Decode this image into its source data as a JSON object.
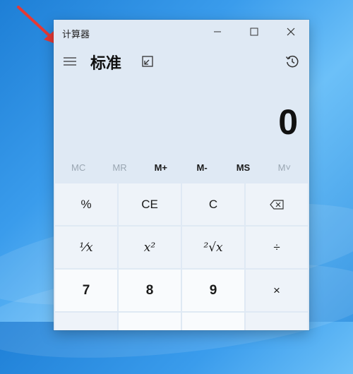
{
  "window": {
    "title": "计算器"
  },
  "header": {
    "mode": "标准"
  },
  "display": {
    "value": "0"
  },
  "memory": [
    {
      "label": "MC",
      "enabled": false
    },
    {
      "label": "MR",
      "enabled": false
    },
    {
      "label": "M+",
      "enabled": true
    },
    {
      "label": "M-",
      "enabled": true
    },
    {
      "label": "MS",
      "enabled": true
    },
    {
      "label": "M˅",
      "enabled": false
    }
  ],
  "keys": {
    "percent": "%",
    "ce": "CE",
    "c": "C",
    "reciprocal": "¹⁄x",
    "square": "x²",
    "sqrt": "²√x",
    "divide": "÷",
    "seven": "7",
    "eight": "8",
    "nine": "9",
    "multiply": "×"
  },
  "colors": {
    "window_bg": "#dfe9f4",
    "key_bg": "#eef3f9",
    "num_key_bg": "#f9fbfd",
    "annotation_arrow": "#e53935"
  }
}
